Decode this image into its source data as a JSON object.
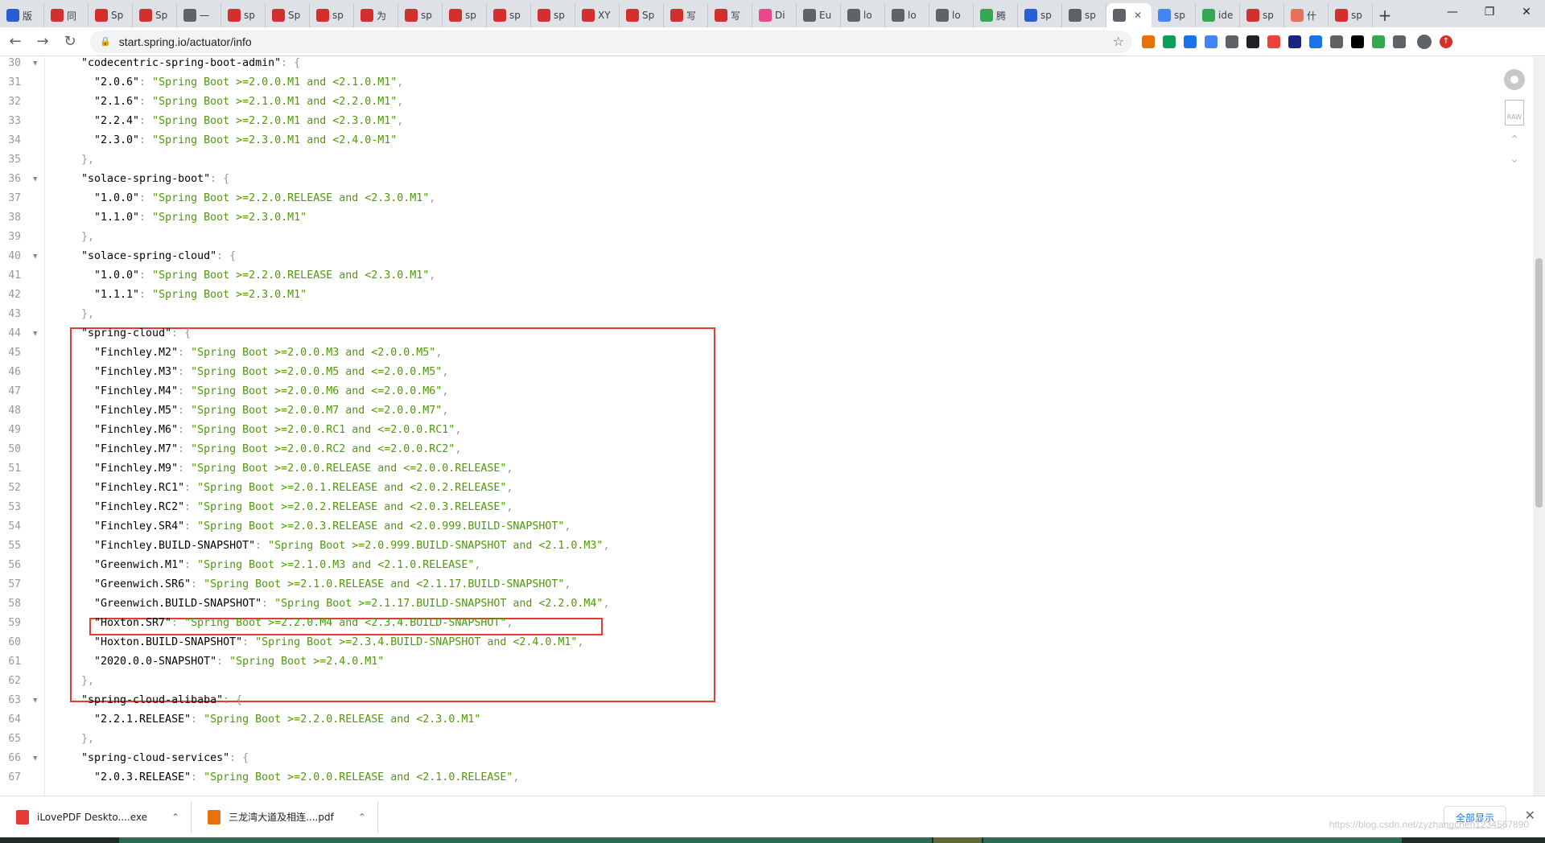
{
  "browser": {
    "tabs": [
      {
        "label": "版",
        "fav": "baidu-icon",
        "color": "#2a5cd6"
      },
      {
        "label": "同",
        "fav": "csdn-icon",
        "color": "#d32f2f"
      },
      {
        "label": "Sp",
        "fav": "csdn-icon",
        "color": "#d32f2f"
      },
      {
        "label": "Sp",
        "fav": "csdn-icon",
        "color": "#d32f2f"
      },
      {
        "label": "一",
        "fav": "translate-icon",
        "color": "#5f6368"
      },
      {
        "label": "sp",
        "fav": "csdn-icon",
        "color": "#d32f2f"
      },
      {
        "label": "Sp",
        "fav": "csdn-icon",
        "color": "#d32f2f"
      },
      {
        "label": "sp",
        "fav": "csdn-icon",
        "color": "#d32f2f"
      },
      {
        "label": "为",
        "fav": "csdn-icon",
        "color": "#d32f2f"
      },
      {
        "label": "sp",
        "fav": "csdn-icon",
        "color": "#d32f2f"
      },
      {
        "label": "sp",
        "fav": "csdn-icon",
        "color": "#d32f2f"
      },
      {
        "label": "sp",
        "fav": "csdn-icon",
        "color": "#d32f2f"
      },
      {
        "label": "sp",
        "fav": "csdn-icon",
        "color": "#d32f2f"
      },
      {
        "label": "XY",
        "fav": "csdn-icon",
        "color": "#d32f2f"
      },
      {
        "label": "Sp",
        "fav": "csdn-icon",
        "color": "#d32f2f"
      },
      {
        "label": "写",
        "fav": "csdn-icon",
        "color": "#d32f2f"
      },
      {
        "label": "写",
        "fav": "csdn-icon",
        "color": "#d32f2f"
      },
      {
        "label": "Di",
        "fav": "kibana-icon",
        "color": "#e8488b"
      },
      {
        "label": "Eu",
        "fav": "globe-icon",
        "color": "#5f6368"
      },
      {
        "label": "lo",
        "fav": "globe-icon",
        "color": "#5f6368"
      },
      {
        "label": "lo",
        "fav": "globe-icon",
        "color": "#5f6368"
      },
      {
        "label": "lo",
        "fav": "globe-icon",
        "color": "#5f6368"
      },
      {
        "label": "腾",
        "fav": "chrome-icon",
        "color": "#34a853"
      },
      {
        "label": "sp",
        "fav": "baidu-icon",
        "color": "#2a5cd6"
      },
      {
        "label": "sp",
        "fav": "translate-icon",
        "color": "#5f6368"
      },
      {
        "label": "",
        "fav": "globe-icon",
        "color": "#5f6368",
        "active": true
      },
      {
        "label": "sp",
        "fav": "edit-icon",
        "color": "#4285f4"
      },
      {
        "label": "ide",
        "fav": "c-icon",
        "color": "#34a853"
      },
      {
        "label": "sp",
        "fav": "csdn-icon",
        "color": "#d32f2f"
      },
      {
        "label": "什",
        "fav": "jianshu-icon",
        "color": "#ea6f5a"
      },
      {
        "label": "sp",
        "fav": "csdn-icon",
        "color": "#d32f2f"
      }
    ],
    "new_tab": "+",
    "url": "start.spring.io/actuator/info",
    "extensions": [
      "#e8710a",
      "#0f9d58",
      "#1a73e8",
      "#4285f4",
      "#5f6368",
      "#202124",
      "#ea4335",
      "#1a237e",
      "#1a73e8",
      "#5f6368",
      "#000000",
      "#34a853",
      "#5f6368"
    ]
  },
  "code": {
    "lines": [
      {
        "n": "30",
        "fold": true,
        "indent": 2,
        "segments": [
          [
            "k",
            "\"codecentric-spring-boot-admin\""
          ],
          [
            "p",
            ": {"
          ]
        ]
      },
      {
        "n": "31",
        "indent": 4,
        "segments": [
          [
            "k",
            "\"2.0.6\""
          ],
          [
            "p",
            ": "
          ],
          [
            "s",
            "\"Spring Boot >=2.0.0.M1 and <2.1.0.M1\""
          ],
          [
            "p",
            ","
          ]
        ]
      },
      {
        "n": "32",
        "indent": 4,
        "segments": [
          [
            "k",
            "\"2.1.6\""
          ],
          [
            "p",
            ": "
          ],
          [
            "s",
            "\"Spring Boot >=2.1.0.M1 and <2.2.0.M1\""
          ],
          [
            "p",
            ","
          ]
        ]
      },
      {
        "n": "33",
        "indent": 4,
        "segments": [
          [
            "k",
            "\"2.2.4\""
          ],
          [
            "p",
            ": "
          ],
          [
            "s",
            "\"Spring Boot >=2.2.0.M1 and <2.3.0.M1\""
          ],
          [
            "p",
            ","
          ]
        ]
      },
      {
        "n": "34",
        "indent": 4,
        "segments": [
          [
            "k",
            "\"2.3.0\""
          ],
          [
            "p",
            ": "
          ],
          [
            "s",
            "\"Spring Boot >=2.3.0.M1 and <2.4.0-M1\""
          ]
        ]
      },
      {
        "n": "35",
        "indent": 2,
        "segments": [
          [
            "p",
            "},"
          ]
        ]
      },
      {
        "n": "36",
        "fold": true,
        "indent": 2,
        "segments": [
          [
            "k",
            "\"solace-spring-boot\""
          ],
          [
            "p",
            ": {"
          ]
        ]
      },
      {
        "n": "37",
        "indent": 4,
        "segments": [
          [
            "k",
            "\"1.0.0\""
          ],
          [
            "p",
            ": "
          ],
          [
            "s",
            "\"Spring Boot >=2.2.0.RELEASE and <2.3.0.M1\""
          ],
          [
            "p",
            ","
          ]
        ]
      },
      {
        "n": "38",
        "indent": 4,
        "segments": [
          [
            "k",
            "\"1.1.0\""
          ],
          [
            "p",
            ": "
          ],
          [
            "s",
            "\"Spring Boot >=2.3.0.M1\""
          ]
        ]
      },
      {
        "n": "39",
        "indent": 2,
        "segments": [
          [
            "p",
            "},"
          ]
        ]
      },
      {
        "n": "40",
        "fold": true,
        "indent": 2,
        "segments": [
          [
            "k",
            "\"solace-spring-cloud\""
          ],
          [
            "p",
            ": {"
          ]
        ]
      },
      {
        "n": "41",
        "indent": 4,
        "segments": [
          [
            "k",
            "\"1.0.0\""
          ],
          [
            "p",
            ": "
          ],
          [
            "s",
            "\"Spring Boot >=2.2.0.RELEASE and <2.3.0.M1\""
          ],
          [
            "p",
            ","
          ]
        ]
      },
      {
        "n": "42",
        "indent": 4,
        "segments": [
          [
            "k",
            "\"1.1.1\""
          ],
          [
            "p",
            ": "
          ],
          [
            "s",
            "\"Spring Boot >=2.3.0.M1\""
          ]
        ]
      },
      {
        "n": "43",
        "indent": 2,
        "segments": [
          [
            "p",
            "},"
          ]
        ]
      },
      {
        "n": "44",
        "fold": true,
        "indent": 2,
        "segments": [
          [
            "k",
            "\"spring-cloud\""
          ],
          [
            "p",
            ": {"
          ]
        ]
      },
      {
        "n": "45",
        "indent": 4,
        "segments": [
          [
            "k",
            "\"Finchley.M2\""
          ],
          [
            "p",
            ": "
          ],
          [
            "s",
            "\"Spring Boot >=2.0.0.M3 and <2.0.0.M5\""
          ],
          [
            "p",
            ","
          ]
        ]
      },
      {
        "n": "46",
        "indent": 4,
        "segments": [
          [
            "k",
            "\"Finchley.M3\""
          ],
          [
            "p",
            ": "
          ],
          [
            "s",
            "\"Spring Boot >=2.0.0.M5 and <=2.0.0.M5\""
          ],
          [
            "p",
            ","
          ]
        ]
      },
      {
        "n": "47",
        "indent": 4,
        "segments": [
          [
            "k",
            "\"Finchley.M4\""
          ],
          [
            "p",
            ": "
          ],
          [
            "s",
            "\"Spring Boot >=2.0.0.M6 and <=2.0.0.M6\""
          ],
          [
            "p",
            ","
          ]
        ]
      },
      {
        "n": "48",
        "indent": 4,
        "segments": [
          [
            "k",
            "\"Finchley.M5\""
          ],
          [
            "p",
            ": "
          ],
          [
            "s",
            "\"Spring Boot >=2.0.0.M7 and <=2.0.0.M7\""
          ],
          [
            "p",
            ","
          ]
        ]
      },
      {
        "n": "49",
        "indent": 4,
        "segments": [
          [
            "k",
            "\"Finchley.M6\""
          ],
          [
            "p",
            ": "
          ],
          [
            "s",
            "\"Spring Boot >=2.0.0.RC1 and <=2.0.0.RC1\""
          ],
          [
            "p",
            ","
          ]
        ]
      },
      {
        "n": "50",
        "indent": 4,
        "segments": [
          [
            "k",
            "\"Finchley.M7\""
          ],
          [
            "p",
            ": "
          ],
          [
            "s",
            "\"Spring Boot >=2.0.0.RC2 and <=2.0.0.RC2\""
          ],
          [
            "p",
            ","
          ]
        ]
      },
      {
        "n": "51",
        "indent": 4,
        "segments": [
          [
            "k",
            "\"Finchley.M9\""
          ],
          [
            "p",
            ": "
          ],
          [
            "s",
            "\"Spring Boot >=2.0.0.RELEASE and <=2.0.0.RELEASE\""
          ],
          [
            "p",
            ","
          ]
        ]
      },
      {
        "n": "52",
        "indent": 4,
        "segments": [
          [
            "k",
            "\"Finchley.RC1\""
          ],
          [
            "p",
            ": "
          ],
          [
            "s",
            "\"Spring Boot >=2.0.1.RELEASE and <2.0.2.RELEASE\""
          ],
          [
            "p",
            ","
          ]
        ]
      },
      {
        "n": "53",
        "indent": 4,
        "segments": [
          [
            "k",
            "\"Finchley.RC2\""
          ],
          [
            "p",
            ": "
          ],
          [
            "s",
            "\"Spring Boot >=2.0.2.RELEASE and <2.0.3.RELEASE\""
          ],
          [
            "p",
            ","
          ]
        ]
      },
      {
        "n": "54",
        "indent": 4,
        "segments": [
          [
            "k",
            "\"Finchley.SR4\""
          ],
          [
            "p",
            ": "
          ],
          [
            "s",
            "\"Spring Boot >=2.0.3.RELEASE and <2.0.999.BUILD-SNAPSHOT\""
          ],
          [
            "p",
            ","
          ]
        ]
      },
      {
        "n": "55",
        "indent": 4,
        "segments": [
          [
            "k",
            "\"Finchley.BUILD-SNAPSHOT\""
          ],
          [
            "p",
            ": "
          ],
          [
            "s",
            "\"Spring Boot >=2.0.999.BUILD-SNAPSHOT and <2.1.0.M3\""
          ],
          [
            "p",
            ","
          ]
        ]
      },
      {
        "n": "56",
        "indent": 4,
        "segments": [
          [
            "k",
            "\"Greenwich.M1\""
          ],
          [
            "p",
            ": "
          ],
          [
            "s",
            "\"Spring Boot >=2.1.0.M3 and <2.1.0.RELEASE\""
          ],
          [
            "p",
            ","
          ]
        ]
      },
      {
        "n": "57",
        "indent": 4,
        "segments": [
          [
            "k",
            "\"Greenwich.SR6\""
          ],
          [
            "p",
            ": "
          ],
          [
            "s",
            "\"Spring Boot >=2.1.0.RELEASE and <2.1.17.BUILD-SNAPSHOT\""
          ],
          [
            "p",
            ","
          ]
        ]
      },
      {
        "n": "58",
        "indent": 4,
        "segments": [
          [
            "k",
            "\"Greenwich.BUILD-SNAPSHOT\""
          ],
          [
            "p",
            ": "
          ],
          [
            "s",
            "\"Spring Boot >=2.1.17.BUILD-SNAPSHOT and <2.2.0.M4\""
          ],
          [
            "p",
            ","
          ]
        ]
      },
      {
        "n": "59",
        "indent": 4,
        "segments": [
          [
            "k",
            "\"Hoxton.SR7\""
          ],
          [
            "p",
            ": "
          ],
          [
            "s",
            "\"Spring Boot >=2.2.0.M4 and <2.3.4.BUILD-SNAPSHOT\""
          ],
          [
            "p",
            ","
          ]
        ]
      },
      {
        "n": "60",
        "indent": 4,
        "segments": [
          [
            "k",
            "\"Hoxton.BUILD-SNAPSHOT\""
          ],
          [
            "p",
            ": "
          ],
          [
            "s",
            "\"Spring Boot >=2.3.4.BUILD-SNAPSHOT and <2.4.0.M1\""
          ],
          [
            "p",
            ","
          ]
        ]
      },
      {
        "n": "61",
        "indent": 4,
        "segments": [
          [
            "k",
            "\"2020.0.0-SNAPSHOT\""
          ],
          [
            "p",
            ": "
          ],
          [
            "s",
            "\"Spring Boot >=2.4.0.M1\""
          ]
        ]
      },
      {
        "n": "62",
        "indent": 2,
        "segments": [
          [
            "p",
            "},"
          ]
        ]
      },
      {
        "n": "63",
        "fold": true,
        "indent": 2,
        "segments": [
          [
            "k",
            "\"spring-cloud-alibaba\""
          ],
          [
            "p",
            ": {"
          ]
        ]
      },
      {
        "n": "64",
        "indent": 4,
        "segments": [
          [
            "k",
            "\"2.2.1.RELEASE\""
          ],
          [
            "p",
            ": "
          ],
          [
            "s",
            "\"Spring Boot >=2.2.0.RELEASE and <2.3.0.M1\""
          ]
        ]
      },
      {
        "n": "65",
        "indent": 2,
        "segments": [
          [
            "p",
            "},"
          ]
        ]
      },
      {
        "n": "66",
        "fold": true,
        "indent": 2,
        "segments": [
          [
            "k",
            "\"spring-cloud-services\""
          ],
          [
            "p",
            ": {"
          ]
        ]
      },
      {
        "n": "67",
        "indent": 4,
        "segments": [
          [
            "k",
            "\"2.0.3.RELEASE\""
          ],
          [
            "p",
            ": "
          ],
          [
            "s",
            "\"Spring Boot >=2.0.0.RELEASE and <2.1.0.RELEASE\""
          ],
          [
            "p",
            ","
          ]
        ]
      }
    ],
    "side_raw_label": "RAW"
  },
  "downloads": {
    "items": [
      {
        "name": "iLovePDF Deskto....exe",
        "icon": "ilovepdf-icon",
        "color": "#e53935"
      },
      {
        "name": "三龙湾大道及相连....pdf",
        "icon": "pdf-icon",
        "color": "#e8710a"
      }
    ],
    "show_all": "全部显示",
    "watermark": "https://blog.csdn.net/zyzhangchen1234567890"
  }
}
